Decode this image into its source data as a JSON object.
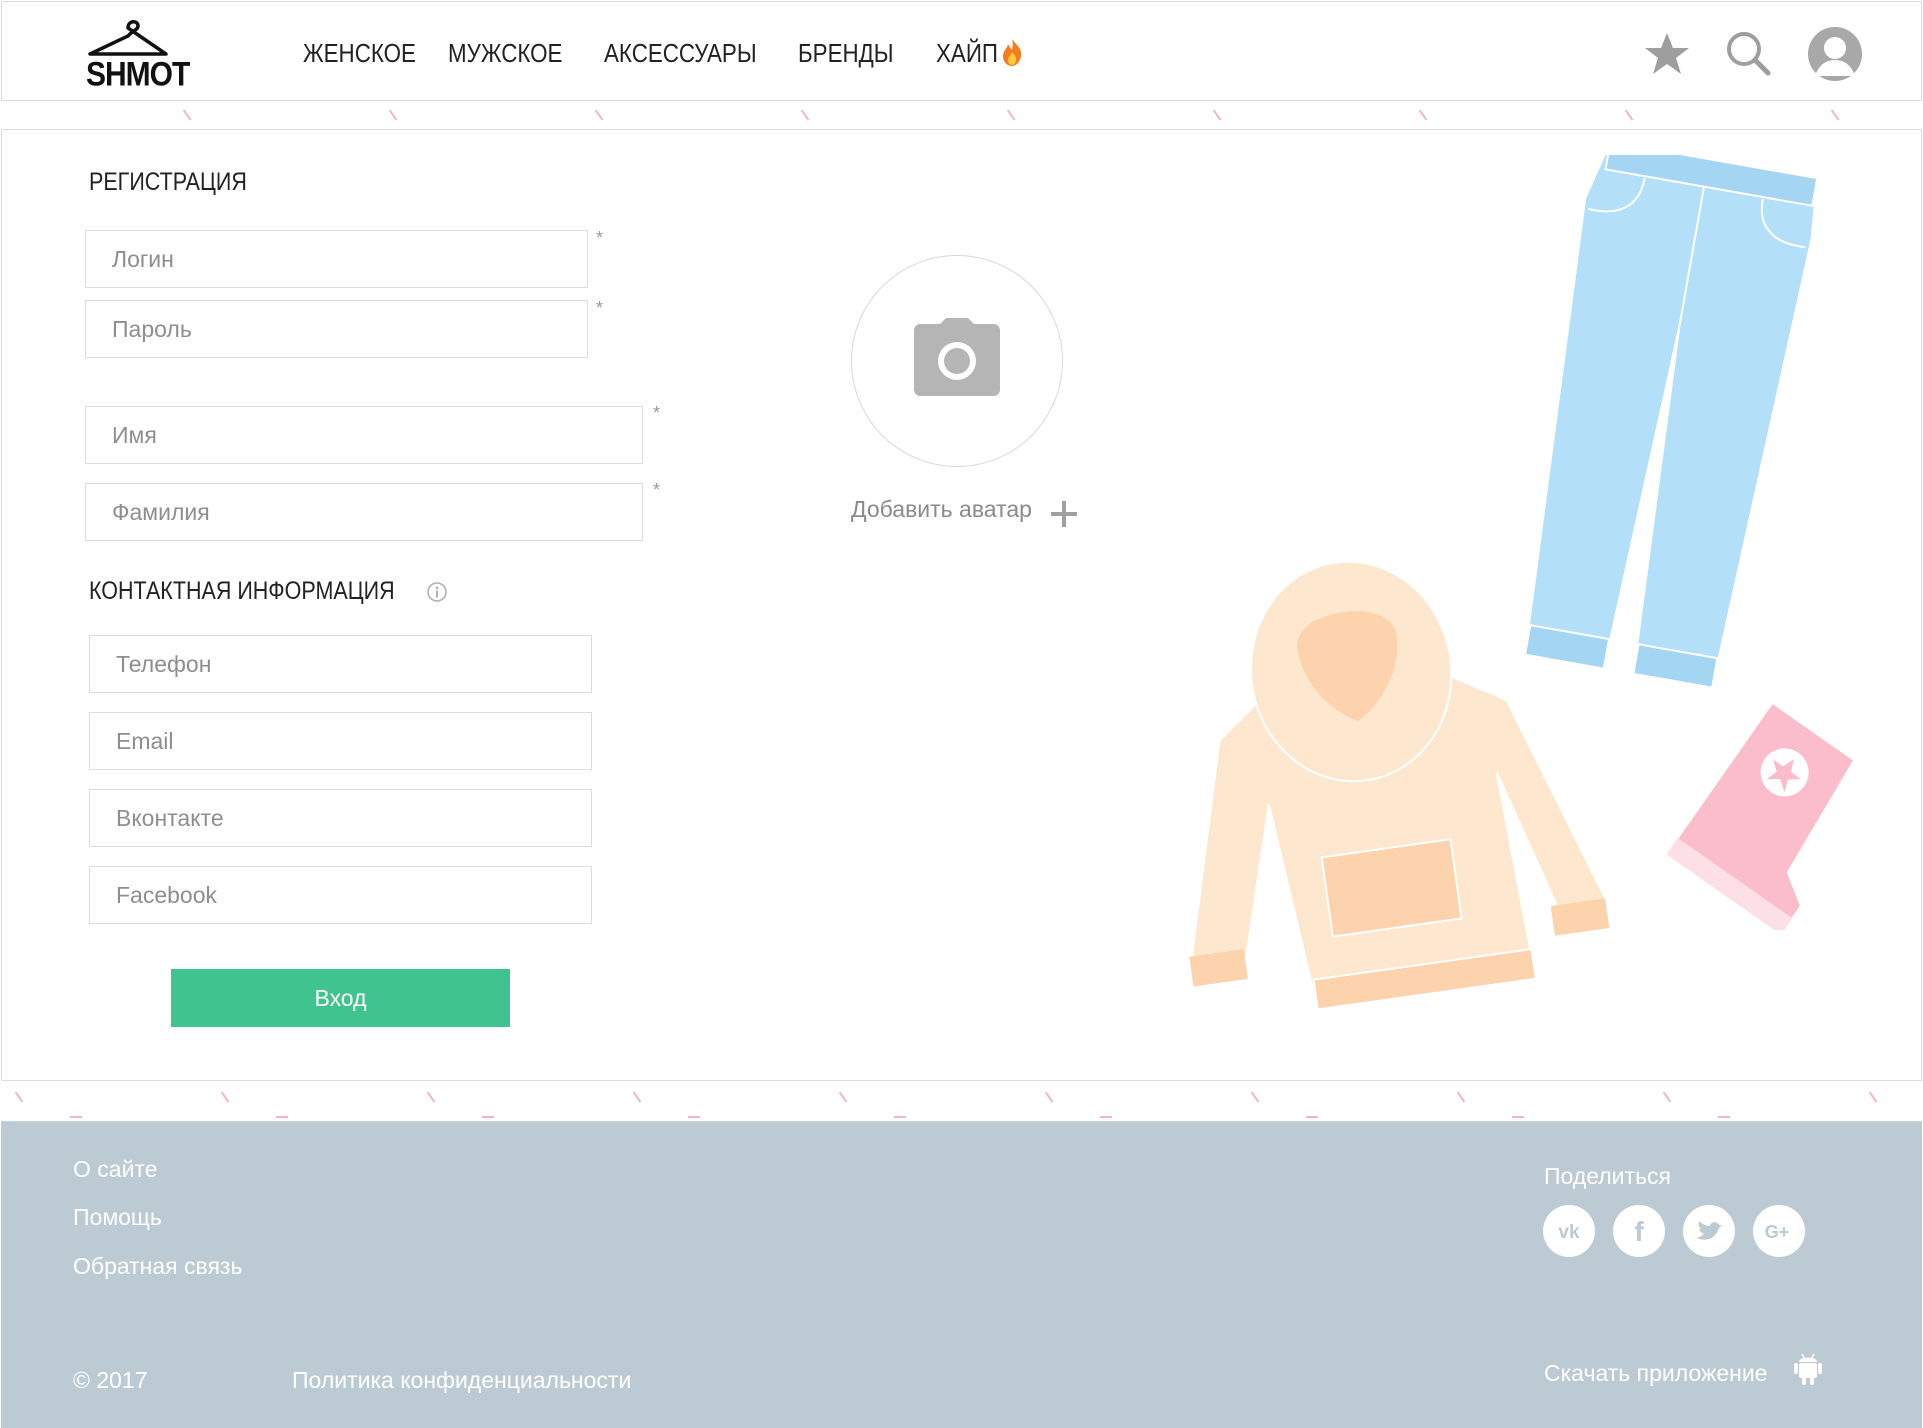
{
  "header": {
    "logo_text": "SHMOT",
    "nav": [
      "ЖЕНСКОЕ",
      "МУЖСКОЕ",
      "АКСЕССУАРЫ",
      "БРЕНДЫ",
      "ХАЙП"
    ],
    "icons": [
      "star-icon",
      "search-icon",
      "user-avatar-icon",
      "fire-icon"
    ]
  },
  "registration": {
    "title": "РЕГИСТРАЦИЯ",
    "login_placeholder": "Логин",
    "password_placeholder": "Пароль",
    "name_placeholder": "Имя",
    "surname_placeholder": "Фамилия",
    "required_mark": "*"
  },
  "contact": {
    "title": "КОНТАКТНАЯ ИНФОРМАЦИЯ",
    "phone_placeholder": "Телефон",
    "email_placeholder": "Email",
    "vk_placeholder": "Вконтакте",
    "facebook_placeholder": "Facebook"
  },
  "actions": {
    "login_button": "Вход"
  },
  "avatar": {
    "add_label": "Добавить аватар"
  },
  "footer": {
    "links": [
      "О сайте",
      "Помощь",
      "Обратная связь"
    ],
    "copyright": "© 2017",
    "privacy": "Политика конфиденциальности",
    "share_label": "Поделиться",
    "social": [
      "vk-icon",
      "facebook-icon",
      "twitter-icon",
      "google-plus-icon"
    ],
    "download_app": "Скачать приложение"
  },
  "colors": {
    "accent_green": "#40c48f",
    "footer_bg": "#bccad3",
    "dash_pink": "#f2b6c3"
  }
}
